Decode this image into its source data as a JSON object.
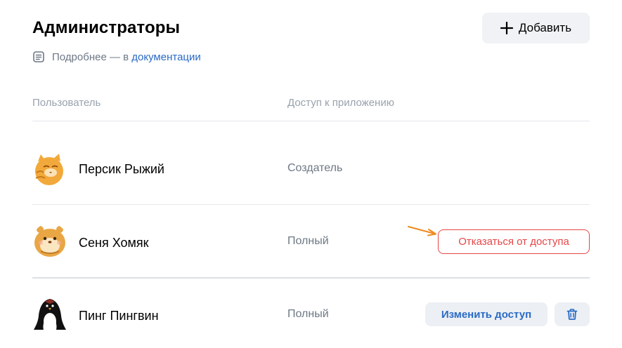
{
  "header": {
    "title": "Администраторы",
    "add_label": "Добавить"
  },
  "docs": {
    "prefix": "Подробнее — в ",
    "link_text": "документации"
  },
  "table": {
    "columns": [
      "Пользователь",
      "Доступ к приложению"
    ],
    "rows": [
      {
        "name": "Персик Рыжий",
        "access": "Создатель"
      },
      {
        "name": "Сеня Хомяк",
        "access": "Полный",
        "action": "Отказаться от доступа"
      },
      {
        "name": "Пинг Пингвин",
        "access": "Полный",
        "action": "Изменить доступ"
      }
    ]
  },
  "icons": {
    "add": "plus-icon",
    "docs": "document-icon",
    "delete": "trash-icon",
    "annotation": "arrow-icon"
  },
  "colors": {
    "link": "#2a6bc5",
    "danger": "#e64646",
    "secondary_text": "#6d7885",
    "arrow": "#f08a1c"
  }
}
